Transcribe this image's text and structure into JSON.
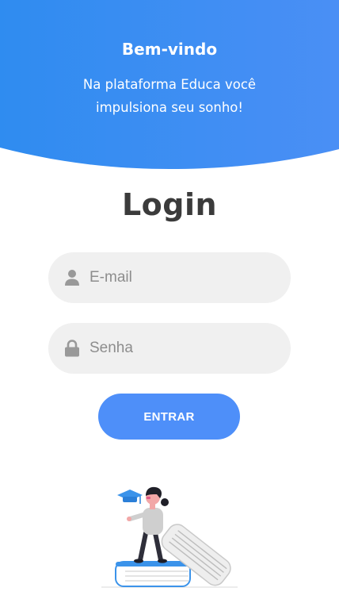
{
  "header": {
    "title": "Bem-vindo",
    "subtitle": "Na plataforma Educa você impulsiona seu sonho!",
    "gradient_start": "#2f8cf0",
    "gradient_end": "#4a8ff5"
  },
  "login": {
    "title": "Login",
    "email_placeholder": "E-mail",
    "email_value": "",
    "password_placeholder": "Senha",
    "password_value": "",
    "submit_label": "ENTRAR",
    "user_icon": "user-icon",
    "lock_icon": "lock-icon"
  },
  "colors": {
    "accent": "#4e8ff9",
    "field_background": "#f0f0f0",
    "title_text": "#3b3b3b",
    "placeholder_text": "#8d8d8d",
    "icon": "#999999"
  },
  "illustration": {
    "name": "student-on-books-illustration"
  }
}
